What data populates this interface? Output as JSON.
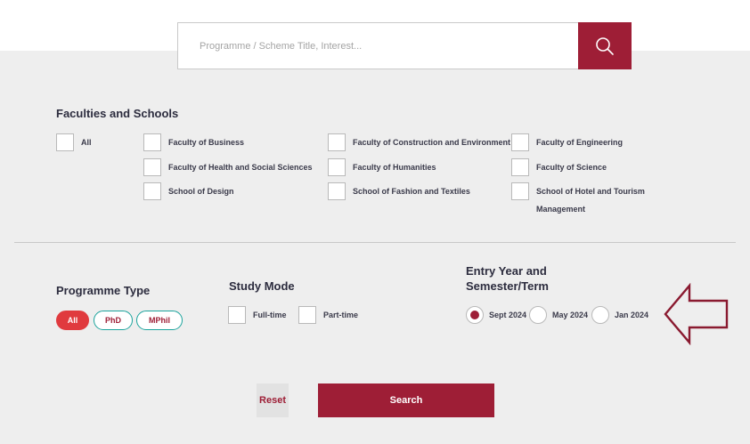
{
  "search": {
    "placeholder": "Programme / Scheme Title, Interest...",
    "button_icon": "search-icon"
  },
  "faculties": {
    "title": "Faculties and Schools",
    "items": [
      {
        "label": "All"
      },
      {
        "label": "Faculty of Business"
      },
      {
        "label": "Faculty of Construction and Environment"
      },
      {
        "label": "Faculty of Engineering"
      },
      {
        "label": "Faculty of Health and Social Sciences"
      },
      {
        "label": "Faculty of Humanities"
      },
      {
        "label": "Faculty of Science"
      },
      {
        "label": "School of Design"
      },
      {
        "label": "School of Fashion and Textiles"
      },
      {
        "label": "School of Hotel and Tourism Management"
      }
    ]
  },
  "programme_type": {
    "title": "Programme Type",
    "options": [
      {
        "label": "All",
        "selected": true
      },
      {
        "label": "PhD",
        "selected": false
      },
      {
        "label": "MPhil",
        "selected": false
      }
    ]
  },
  "study_mode": {
    "title": "Study Mode",
    "options": [
      {
        "label": "Full-time",
        "checked": false
      },
      {
        "label": "Part-time",
        "checked": false
      }
    ]
  },
  "entry": {
    "title_line1": "Entry Year and",
    "title_line2": "Semester/Term",
    "options": [
      {
        "label": "Sept 2024",
        "selected": true
      },
      {
        "label": "May 2024",
        "selected": false
      },
      {
        "label": "Jan 2024",
        "selected": false
      }
    ]
  },
  "actions": {
    "reset_label": "Reset",
    "search_label": "Search"
  },
  "colors": {
    "brand": "#9e1e36",
    "active_pill": "#e03a3e",
    "pill_border": "#1ba39c",
    "panel_bg": "#eeeeee"
  }
}
